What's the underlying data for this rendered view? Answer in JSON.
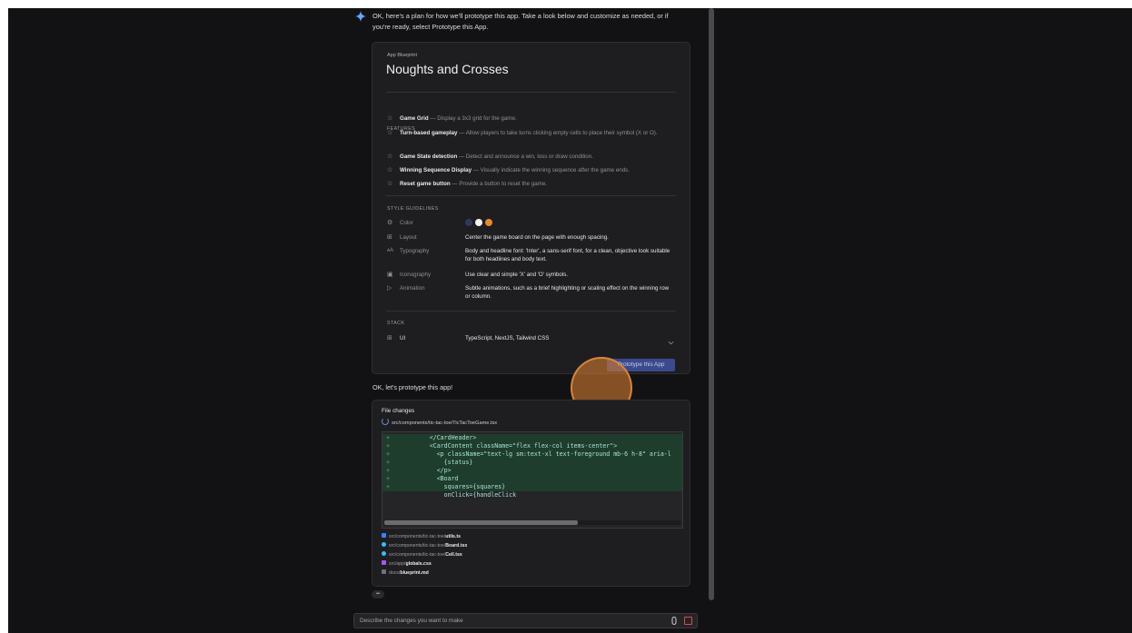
{
  "assistant": {
    "intro_line1": "OK, here's a plan for how we'll prototype this app. Take a look below and customize as needed, or if",
    "intro_line2": "you're ready, select Prototype this App.",
    "followup": "OK, let's prototype this app!"
  },
  "blueprint": {
    "label": "App Blueprint",
    "title": "Noughts and Crosses",
    "features_label": "FEATURES",
    "features": [
      {
        "name": "Game Grid",
        "desc": " — Display a 3x3 grid for the game."
      },
      {
        "name": "Turn-based gameplay",
        "desc": " — Allow players to take turns clicking empty cells to place their symbol (X or O)."
      },
      {
        "name": "Game State detection",
        "desc": " — Detect and announce a win, loss or draw condition."
      },
      {
        "name": "Winning Sequence Display",
        "desc": " — Visually indicate the winning sequence after the game ends."
      },
      {
        "name": "Reset game button",
        "desc": " — Provide a button to reset the game."
      }
    ],
    "style_label": "STYLE GUIDELINES",
    "style": {
      "color_name": "Color",
      "colors": [
        "#2e3a5c",
        "#f2f2f2",
        "#e8892c"
      ],
      "layout_name": "Layout",
      "layout_value": "Center the game board on the page with enough spacing.",
      "typography_name": "Typography",
      "typography_value": "Body and headline font: 'Inter', a sans-serif font, for a clean, objective look suitable for both headlines and body text.",
      "iconography_name": "Iconography",
      "iconography_value": "Use clear and simple 'X' and 'O' symbols.",
      "animation_name": "Animation",
      "animation_value": "Subtle animations, such as a brief highlighting or scaling effect on the winning row or column."
    },
    "stack_label": "STACK",
    "stack": {
      "name": "UI",
      "value": "TypeScript, NextJS, Tailwind CSS"
    },
    "prototype_button": "Prototype this App"
  },
  "file_changes": {
    "title": "File changes",
    "current_file": "src/components/tic-tac-toe/TicTacToeGame.tsx",
    "code_lines": [
      "        </CardHeader>",
      "        <CardContent className=\"flex flex-col items-center\">",
      "          <p className=\"text-lg sm:text-xl text-foreground mb-6 h-8\" aria-l",
      "            {status}",
      "          </p>",
      "          <Board",
      "            squares={squares}",
      "            onClick={handleClick"
    ],
    "files": [
      {
        "dir": "src/components/tic-tac-toe/",
        "name": "utils.ts",
        "icon_color": "#3b82f6"
      },
      {
        "dir": "src/components/tic-tac-toe/",
        "name": "Board.tsx",
        "icon_color": "#38bdf8"
      },
      {
        "dir": "src/components/tic-tac-toe/",
        "name": "Cell.tsx",
        "icon_color": "#38bdf8"
      },
      {
        "dir": "src/app/",
        "name": "globals.css",
        "icon_color": "#a855f7"
      },
      {
        "dir": "docs/",
        "name": "blueprint.md",
        "icon_color": "#6b7280"
      }
    ],
    "more": "••"
  },
  "composer": {
    "placeholder": "Describe the changes you want to make"
  }
}
